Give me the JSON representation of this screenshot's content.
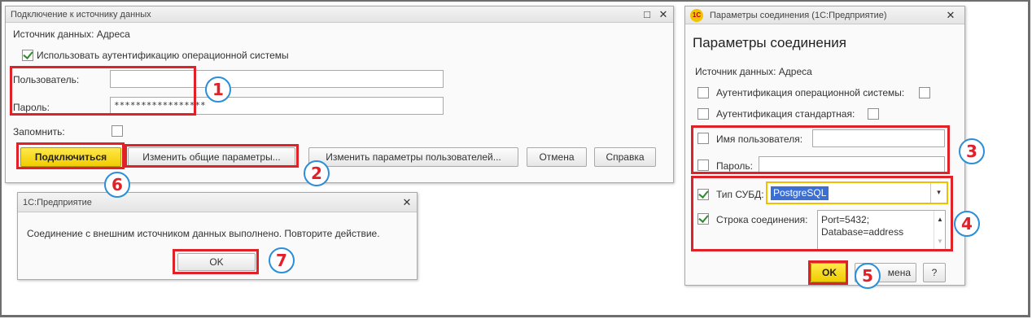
{
  "dialog_connect": {
    "title": "Подключение к источнику данных",
    "source_label": "Источник данных: Адреса",
    "os_auth_label": "Использовать аутентификацию операционной системы",
    "user_label": "Пользователь:",
    "password_label": "Пароль:",
    "password_value": "*****************",
    "remember_label": "Запомнить:",
    "connect_button": "Подключиться",
    "change_common_button": "Изменить общие параметры...",
    "change_user_button": "Изменить параметры пользователей...",
    "cancel_button": "Отмена",
    "help_button": "Справка",
    "minimize_glyph": "□",
    "close_glyph": "✕"
  },
  "dialog_message": {
    "title": "1С:Предприятие",
    "message": "Соединение с внешним источником данных выполнено. Повторите действие.",
    "ok_button": "OK",
    "close_glyph": "✕"
  },
  "dialog_params": {
    "logo": "1С",
    "title": "Параметры соединения (1С:Предприятие)",
    "heading": "Параметры соединения",
    "source_label": "Источник данных: Адреса",
    "os_auth_label": "Аутентификация операционной системы:",
    "std_auth_label": "Аутентификация стандартная:",
    "username_label": "Имя пользователя:",
    "password_label": "Пароль:",
    "dbms_label": "Тип СУБД:",
    "dbms_value": "PostgreSQL",
    "conn_string_label": "Строка соединения:",
    "conn_string_line1": "Port=5432;",
    "conn_string_line2": "Database=address",
    "ok_button": "OK",
    "cancel_button_partial": "мена",
    "help_button": "?",
    "close_glyph": "✕"
  },
  "callouts": [
    "1",
    "2",
    "3",
    "4",
    "5",
    "6",
    "7"
  ],
  "colors": {
    "highlight": "#e02128",
    "callout_ring": "#2a8ed8",
    "primary_button": "#f1cd00"
  }
}
